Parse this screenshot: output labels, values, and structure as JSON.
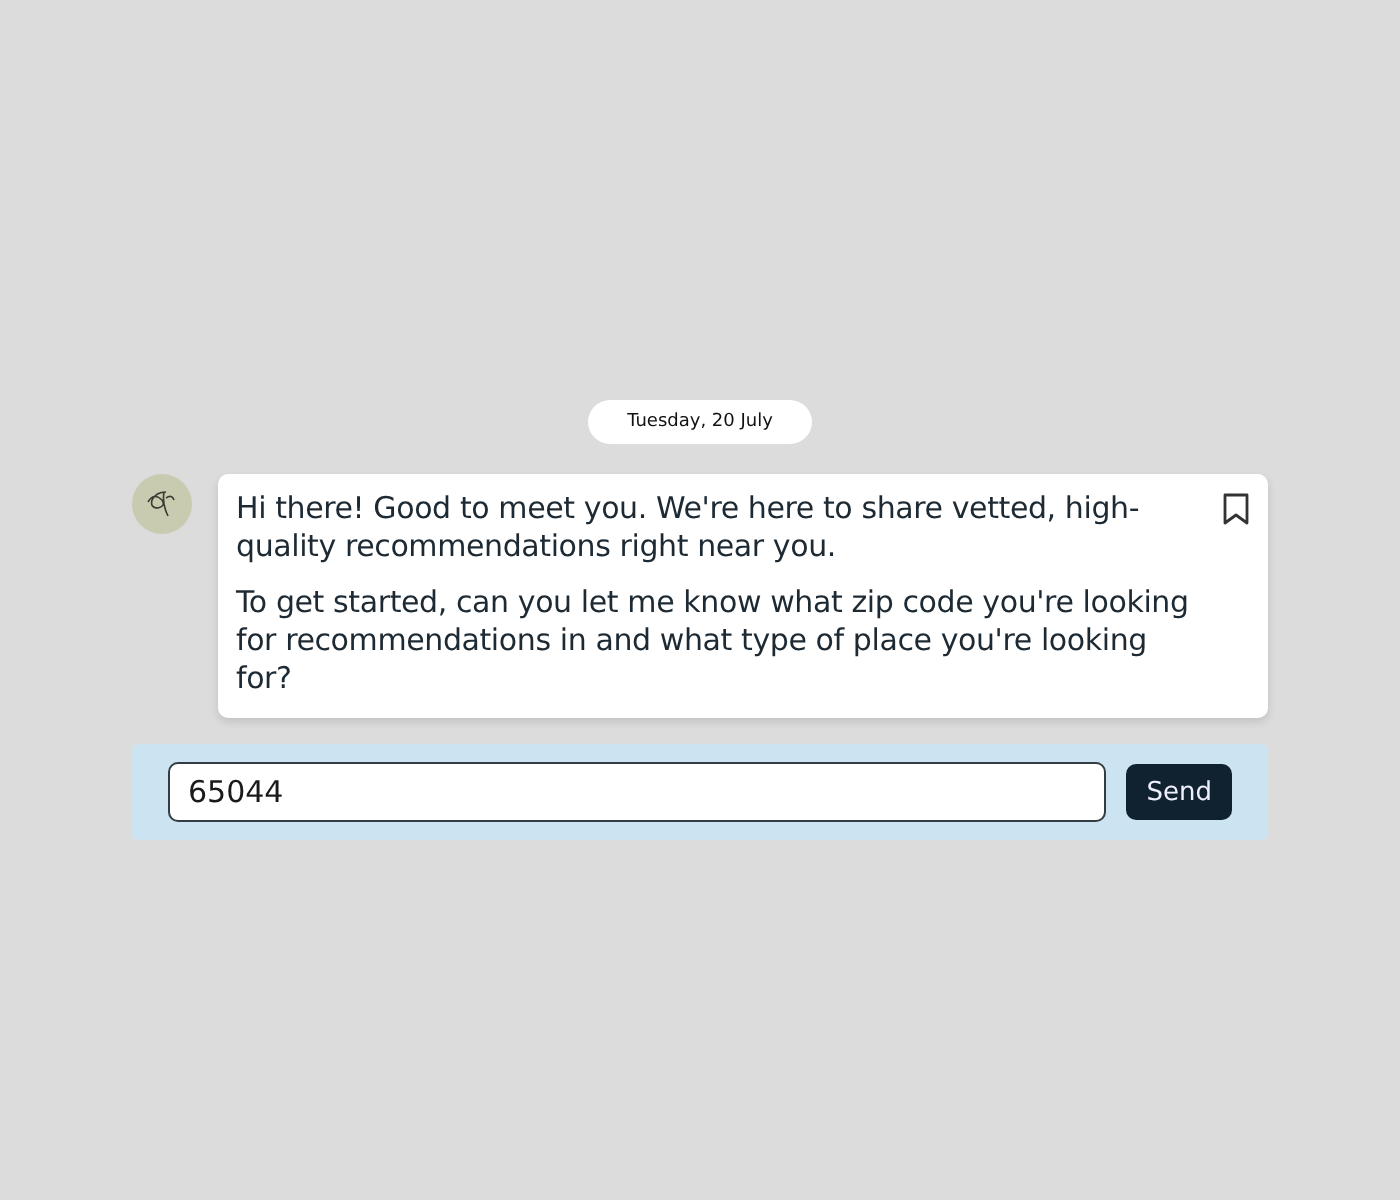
{
  "date": "Tuesday, 20 July",
  "message": {
    "paragraphs": [
      "Hi there! Good to meet you. We're here to share vetted, high-quality recommendations right near you.",
      "To get started, can you let me know what zip code you're looking for recommendations in and what type of place you're looking for?"
    ]
  },
  "composer": {
    "value": "65044",
    "send": "Send"
  }
}
